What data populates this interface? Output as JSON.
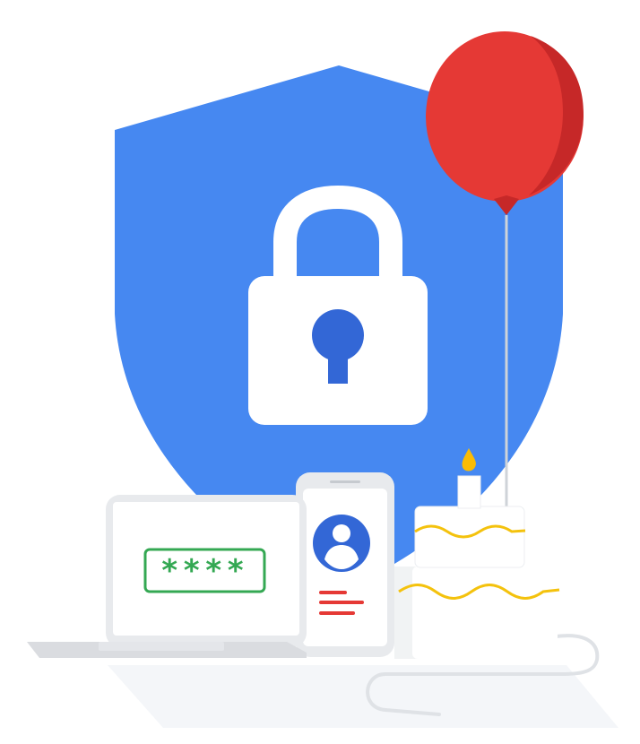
{
  "illustration": {
    "password_field": {
      "text": "****"
    }
  },
  "colors": {
    "shield_blue": "#4688F1",
    "keyhole_blue": "#3367D6",
    "balloon_red": "#E53935",
    "balloon_shade": "#C62828",
    "password_green": "#34A853",
    "candle_flame": "#FBBC04",
    "cake_icing": "#F4C20D",
    "text_red": "#E53935",
    "device_gray": "#E8EAED",
    "screen_white": "#FFFFFF"
  },
  "icons": {
    "lock": "lock-icon",
    "keyhole": "keyhole-icon",
    "user_avatar": "avatar-icon",
    "balloon": "balloon-icon",
    "cake": "cake-icon"
  }
}
